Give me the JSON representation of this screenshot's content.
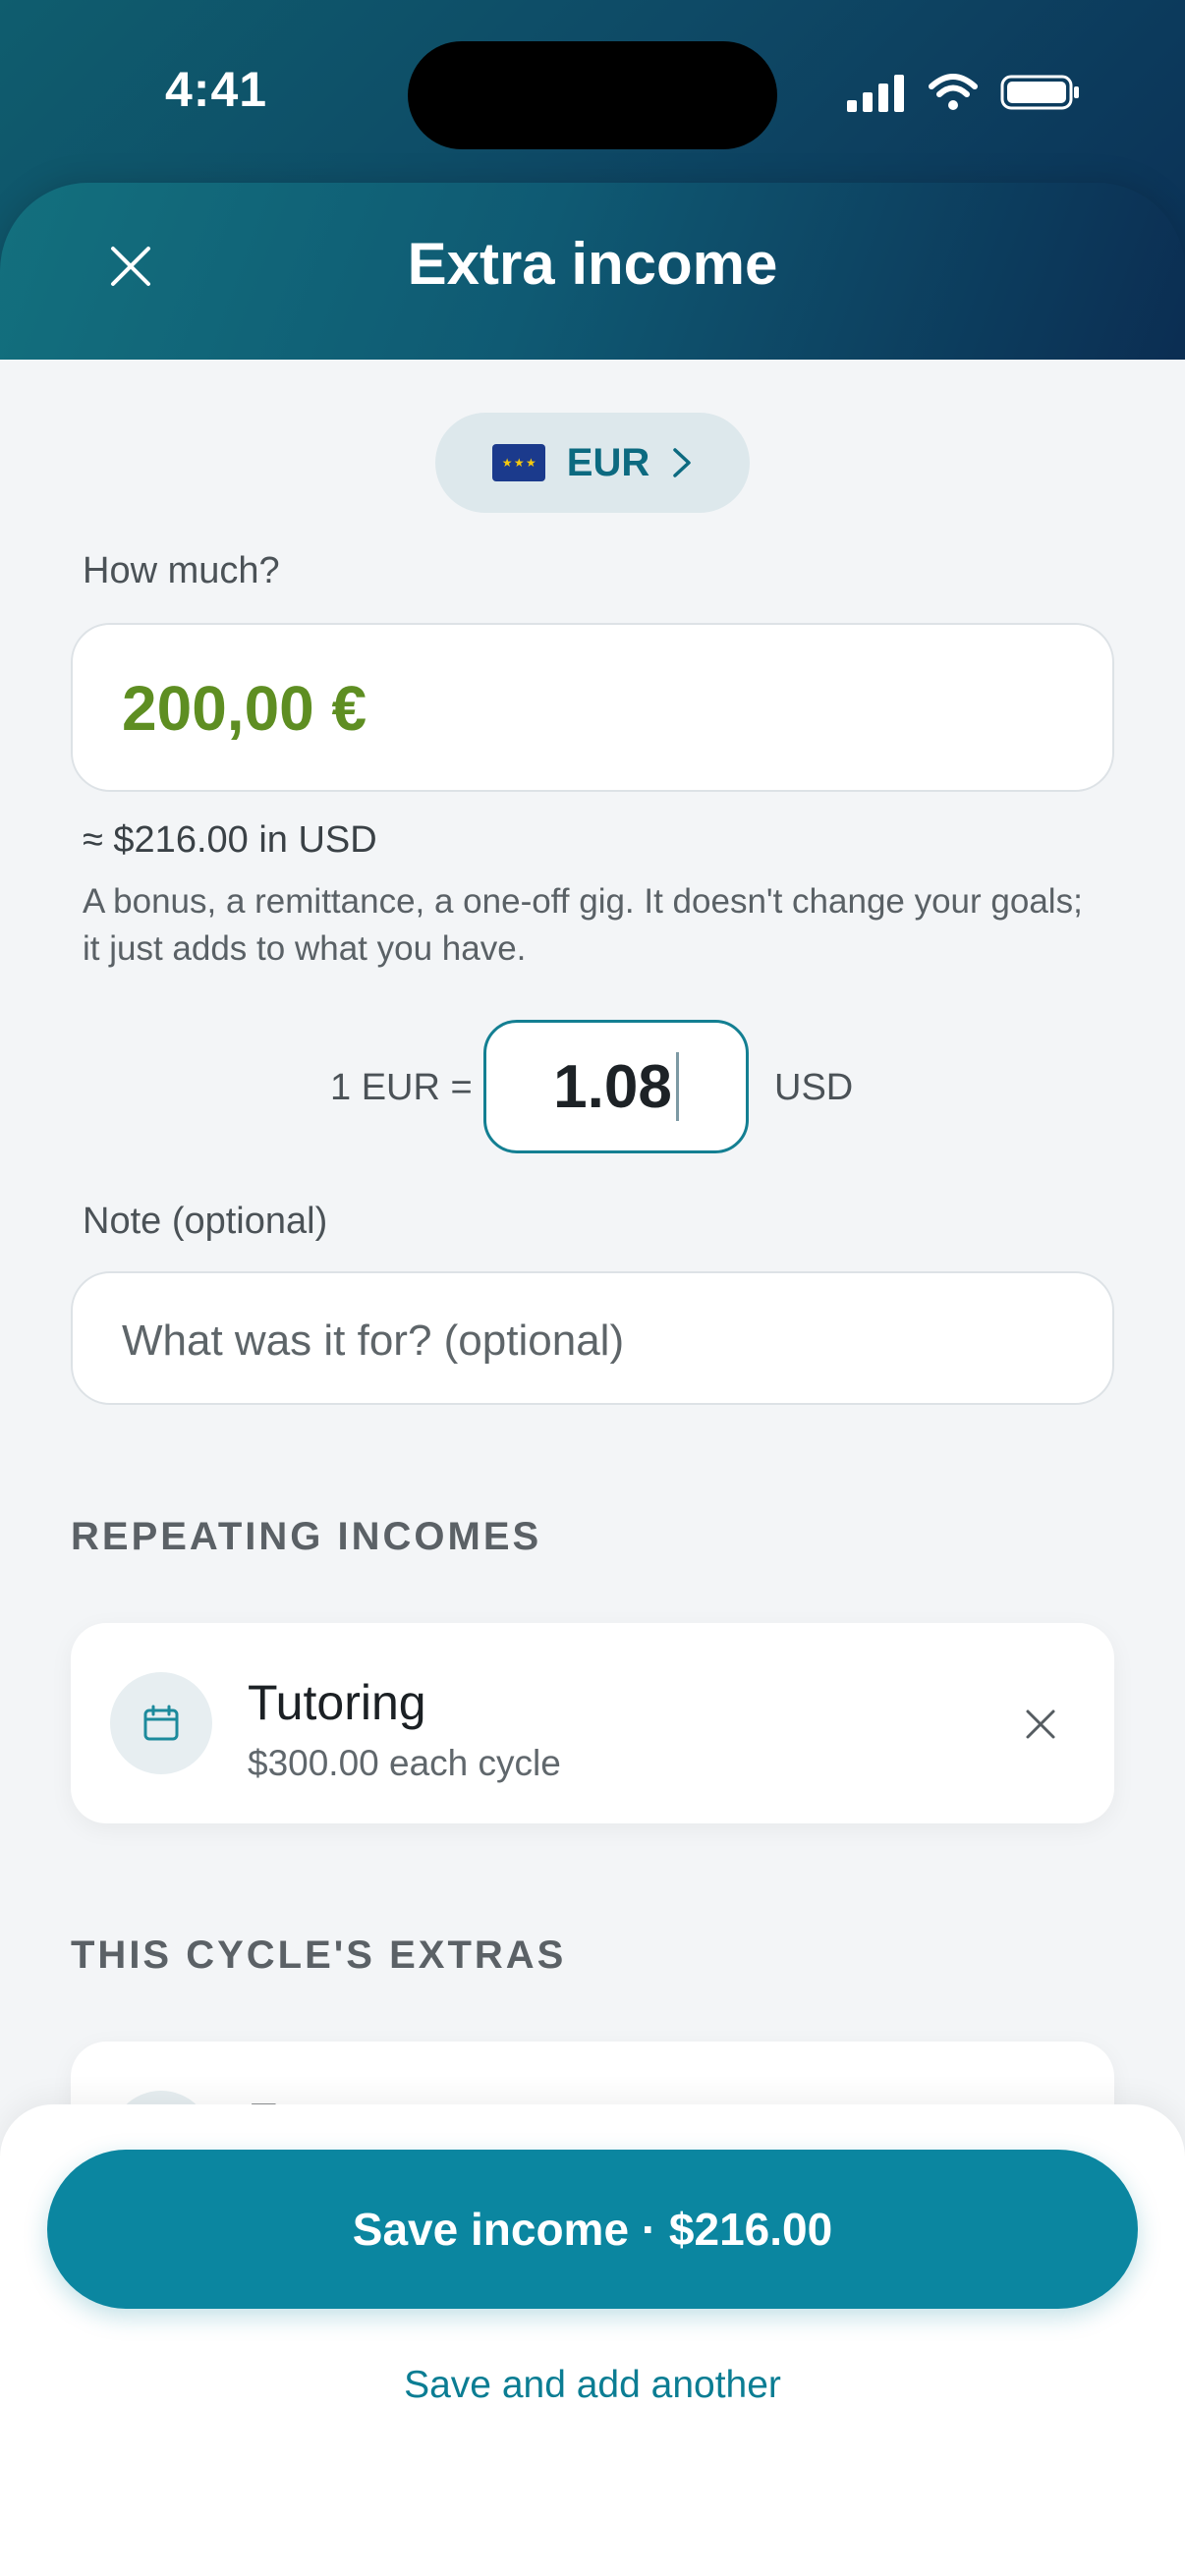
{
  "status_bar": {
    "time": "4:41"
  },
  "header": {
    "title": "Extra income"
  },
  "currency": {
    "code": "EUR",
    "flag": "EU"
  },
  "amount": {
    "label": "How much?",
    "value": "200,00 €",
    "approx": "≈ $216.00 in USD"
  },
  "helper_text": "A bonus, a remittance, a one-off gig. It doesn't change your goals; it just adds to what you have.",
  "rate": {
    "left_label": "1 EUR =",
    "value": "1.08",
    "right_label": "USD"
  },
  "note": {
    "label": "Note (optional)",
    "placeholder": "What was it for? (optional)"
  },
  "repeating": {
    "title": "REPEATING INCOMES",
    "items": [
      {
        "name": "Tutoring",
        "detail": "$300.00 each cycle"
      }
    ]
  },
  "extras": {
    "title": "THIS CYCLE'S EXTRAS",
    "peek_text": "Fr..."
  },
  "actions": {
    "save_label": "Save income · $216.00",
    "save_another_label": "Save and add another"
  },
  "colors": {
    "accent": "#0b86a0",
    "amount_green": "#5e8e22",
    "header_dark": "#0b2d52"
  }
}
